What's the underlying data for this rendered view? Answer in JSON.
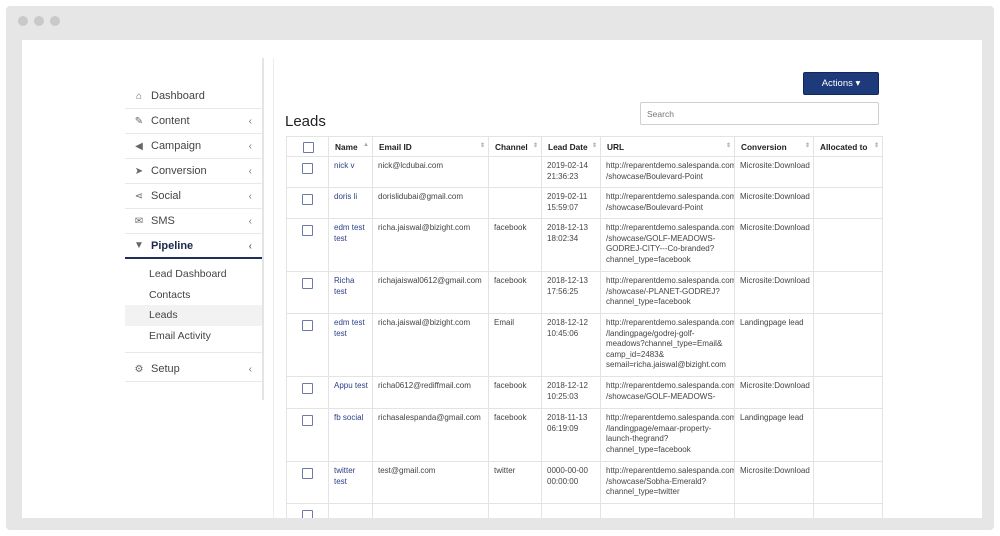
{
  "sidebar": {
    "items": [
      {
        "label": "Dashboard",
        "icon": "home-icon",
        "glyph": "⌂",
        "chevron": ""
      },
      {
        "label": "Content",
        "icon": "edit-icon",
        "glyph": "✎",
        "chevron": "‹"
      },
      {
        "label": "Campaign",
        "icon": "megaphone-icon",
        "glyph": "◀",
        "chevron": "‹"
      },
      {
        "label": "Conversion",
        "icon": "pointer-icon",
        "glyph": "➤",
        "chevron": "‹"
      },
      {
        "label": "Social",
        "icon": "share-icon",
        "glyph": "⋖",
        "chevron": "‹"
      },
      {
        "label": "SMS",
        "icon": "envelope-icon",
        "glyph": "✉",
        "chevron": "‹"
      },
      {
        "label": "Pipeline",
        "icon": "filter-icon",
        "glyph": "▼",
        "chevron": "‹"
      }
    ],
    "pipeline_sub": [
      "Lead Dashboard",
      "Contacts",
      "Leads",
      "Email Activity"
    ],
    "setup": {
      "label": "Setup",
      "icon": "gear-icon",
      "glyph": "⚙",
      "chevron": "‹"
    }
  },
  "header": {
    "actions_label": "Actions ▾",
    "title": "Leads",
    "search_placeholder": "Search"
  },
  "table": {
    "columns": [
      "Name",
      "Email ID",
      "Channel",
      "Lead Date",
      "URL",
      "Conversion",
      "Allocated to"
    ],
    "rows": [
      {
        "name": "nick v",
        "email": "nick@lcdubai.com",
        "channel": "",
        "date": "2019-02-14 21:36:23",
        "url": "http://reparentdemo.salespanda.com /showcase/Boulevard-Point",
        "conversion": "Microsite:Download",
        "allocated": ""
      },
      {
        "name": "doris li",
        "email": "dorislidubai@gmail.com",
        "channel": "",
        "date": "2019-02-11 15:59:07",
        "url": "http://reparentdemo.salespanda.com /showcase/Boulevard-Point",
        "conversion": "Microsite:Download",
        "allocated": ""
      },
      {
        "name": "edm test test",
        "email": "richa.jaiswal@bizight.com",
        "channel": "facebook",
        "date": "2018-12-13 18:02:34",
        "url": "http://reparentdemo.salespanda.com /showcase/GOLF-MEADOWS-GODREJ-CITY---Co-branded?channel_type=facebook",
        "conversion": "Microsite:Download",
        "allocated": ""
      },
      {
        "name": "Richa test",
        "email": "richajaiswal0612@gmail.com",
        "channel": "facebook",
        "date": "2018-12-13 17:56:25",
        "url": "http://reparentdemo.salespanda.com /showcase/-PLANET-GODREJ?channel_type=facebook",
        "conversion": "Microsite:Download",
        "allocated": ""
      },
      {
        "name": "edm test test",
        "email": "richa.jaiswal@bizight.com",
        "channel": "Email",
        "date": "2018-12-12 10:45:06",
        "url": "http://reparentdemo.salespanda.com /landingpage/godrej-golf-meadows?channel_type=Email& camp_id=2483& semail=richa.jaiswal@bizight.com",
        "conversion": "Landingpage lead",
        "allocated": ""
      },
      {
        "name": "Appu test",
        "email": "richa0612@rediffmail.com",
        "channel": "facebook",
        "date": "2018-12-12 10:25:03",
        "url": "http://reparentdemo.salespanda.com /showcase/GOLF-MEADOWS-",
        "conversion": "Microsite:Download",
        "allocated": ""
      },
      {
        "name": "fb social",
        "email": "richasalespanda@gmail.com",
        "channel": "facebook",
        "date": "2018-11-13 06:19:09",
        "url": "http://reparentdemo.salespanda.com /landingpage/emaar-property-launch-thegrand?channel_type=facebook",
        "conversion": "Landingpage lead",
        "allocated": ""
      },
      {
        "name": "twitter test",
        "email": "test@gmail.com",
        "channel": "twitter",
        "date": "0000-00-00 00:00:00",
        "url": "http://reparentdemo.salespanda.com /showcase/Sobha-Emerald?channel_type=twitter",
        "conversion": "Microsite:Download",
        "allocated": ""
      }
    ]
  },
  "colors": {
    "accent": "#1d3b7a",
    "link": "#2b3f86"
  }
}
